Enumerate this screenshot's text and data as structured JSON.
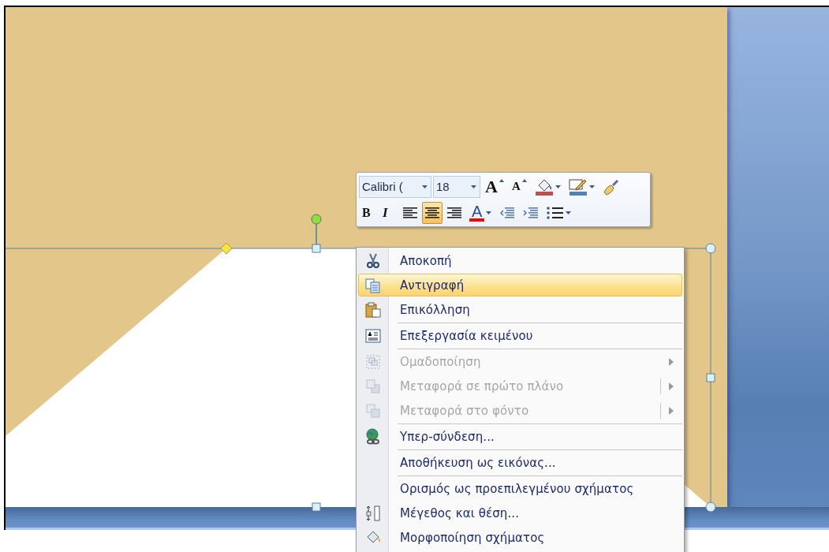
{
  "mini_toolbar": {
    "font": "Calibri (",
    "size": "18",
    "row_1": [
      {
        "kind": "grow",
        "label": "A",
        "dropdown": false
      },
      {
        "kind": "shrink",
        "label": "A",
        "dropdown": false
      },
      {
        "kind": "fill",
        "dropdown": true
      },
      {
        "kind": "outline",
        "dropdown": true
      },
      {
        "kind": "painter",
        "dropdown": false
      }
    ],
    "row_2": [
      {
        "kind": "bold",
        "label": "B",
        "selected": false,
        "dropdown": false
      },
      {
        "kind": "italic",
        "label": "I",
        "selected": false,
        "dropdown": false
      },
      {
        "kind": "align-left",
        "selected": false,
        "dropdown": false
      },
      {
        "kind": "align-center",
        "selected": true,
        "dropdown": false
      },
      {
        "kind": "align-right",
        "selected": false,
        "dropdown": false
      },
      {
        "kind": "font-color",
        "label": "A",
        "selected": false,
        "dropdown": true
      },
      {
        "kind": "outdent",
        "selected": false,
        "dropdown": false
      },
      {
        "kind": "indent",
        "selected": false,
        "dropdown": false
      },
      {
        "kind": "bullets",
        "selected": false,
        "dropdown": true
      }
    ]
  },
  "context_menu": [
    {
      "kind": "cut",
      "label": "Αποκοπή",
      "selected": false,
      "disabled": false,
      "submenu": false,
      "split": false
    },
    {
      "kind": "copy",
      "label": "Αντιγραφή",
      "selected": true,
      "disabled": false,
      "submenu": false,
      "split": false
    },
    {
      "kind": "paste",
      "label": "Επικόλληση",
      "selected": false,
      "disabled": false,
      "submenu": false,
      "split": false
    },
    {
      "kind": "separator"
    },
    {
      "kind": "edit-text",
      "label": "Επεξεργασία κειμένου",
      "selected": false,
      "disabled": false,
      "submenu": false,
      "split": false
    },
    {
      "kind": "separator"
    },
    {
      "kind": "group",
      "label": "Ομαδοποίηση",
      "selected": false,
      "disabled": true,
      "submenu": true,
      "split": false
    },
    {
      "kind": "front",
      "label": "Μεταφορά σε πρώτο πλάνο",
      "selected": false,
      "disabled": true,
      "submenu": true,
      "split": true
    },
    {
      "kind": "back",
      "label": "Μεταφορά στο φόντο",
      "selected": false,
      "disabled": true,
      "submenu": true,
      "split": true
    },
    {
      "kind": "separator"
    },
    {
      "kind": "link",
      "label": "Υπερ-σύνδεση...",
      "selected": false,
      "disabled": false,
      "submenu": false,
      "split": false
    },
    {
      "kind": "separator"
    },
    {
      "kind": "plain",
      "label": "Αποθήκευση ως εικόνας...",
      "selected": false,
      "disabled": false,
      "submenu": false,
      "split": false
    },
    {
      "kind": "separator"
    },
    {
      "kind": "plain",
      "label": "Ορισμός ως προεπιλεγμένου σχήματος",
      "selected": false,
      "disabled": false,
      "submenu": false,
      "split": false
    },
    {
      "kind": "size",
      "label": "Μέγεθος και θέση...",
      "selected": false,
      "disabled": false,
      "submenu": false,
      "split": false
    },
    {
      "kind": "format",
      "label": "Μορφοποίηση σχήματος",
      "selected": false,
      "disabled": false,
      "submenu": false,
      "split": false
    }
  ]
}
